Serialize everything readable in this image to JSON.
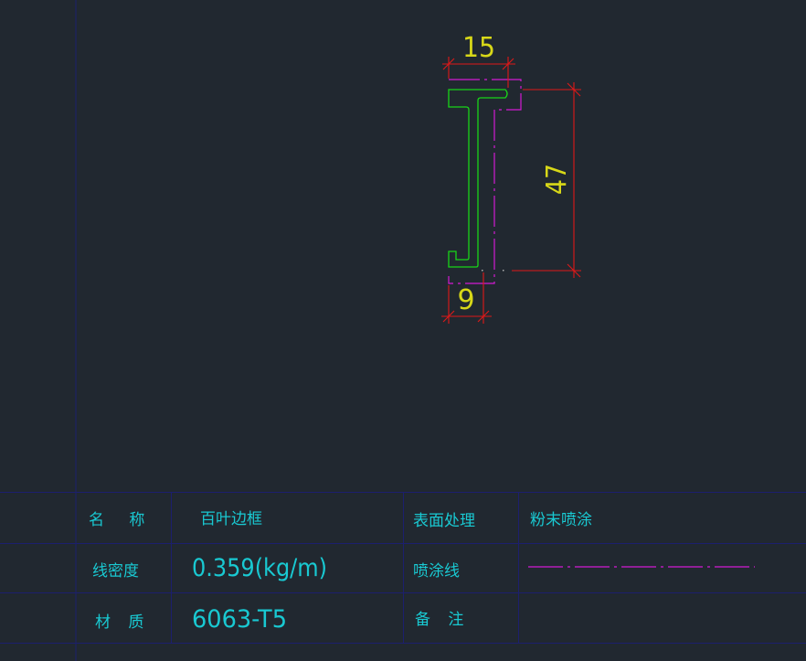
{
  "colors": {
    "background": "#212830",
    "grid_line": "#1c1f6e",
    "profile_green": "#18d418",
    "coating_magenta": "#d21ad2",
    "dimension_red": "#e01818",
    "dimension_text_yellow": "#d8d818",
    "table_text_cyan": "#19c9d2"
  },
  "dimensions": {
    "top_width": "15",
    "height": "47",
    "bottom_width": "9"
  },
  "title_block": {
    "name_label": "名 称",
    "name_value": "百叶边框",
    "surface_label": "表面处理",
    "surface_value": "粉末喷涂",
    "density_label": "线密度",
    "density_value": "0.359(kg/m)",
    "spray_line_label": "喷涂线",
    "material_label": "材 质",
    "material_value": "6063-T5",
    "remarks_label": "备 注"
  }
}
